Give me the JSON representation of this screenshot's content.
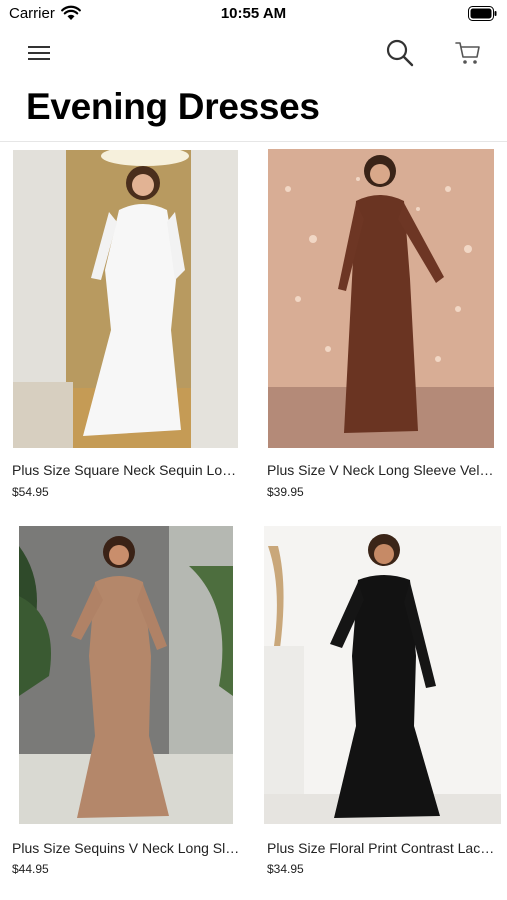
{
  "status_bar": {
    "carrier": "Carrier",
    "time": "10:55 AM"
  },
  "nav": {
    "menu_icon": "hamburger-menu-icon",
    "search_icon": "search-icon",
    "cart_icon": "cart-icon"
  },
  "page": {
    "title": "Evening Dresses"
  },
  "products": [
    {
      "name": "Plus Size Square Neck Sequin Long Sleeve Dress",
      "price": "$54.95"
    },
    {
      "name": "Plus Size V Neck Long Sleeve Velvet Dress",
      "price": "$39.95"
    },
    {
      "name": "Plus Size Sequins V Neck Long Sleeve Dress",
      "price": "$44.95"
    },
    {
      "name": "Plus Size Floral Print Contrast Lace Dress",
      "price": "$34.95"
    }
  ]
}
